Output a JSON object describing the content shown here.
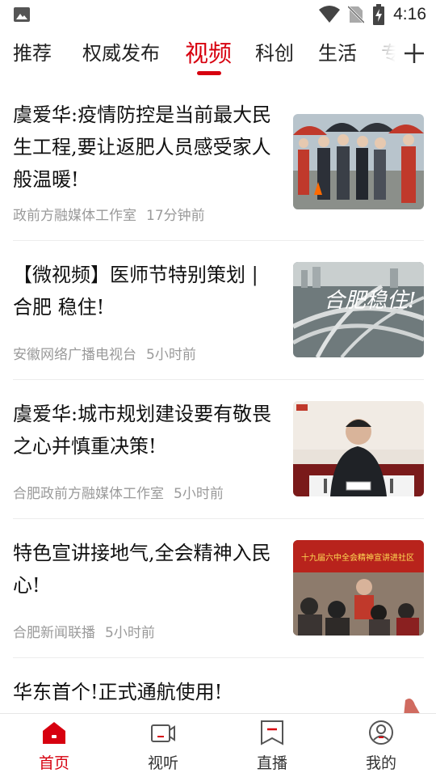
{
  "status_bar": {
    "time": "4:16"
  },
  "tabs": [
    {
      "label": "推荐"
    },
    {
      "label": "权威发布"
    },
    {
      "label": "视频",
      "active": true
    },
    {
      "label": "科创"
    },
    {
      "label": "生活"
    },
    {
      "label": "专"
    }
  ],
  "news": [
    {
      "title": "虞爱华:疫情防控是当前最大民生工程,要让返肥人员感受家人般温暖!",
      "source": "政前方融媒体工作室",
      "time": "17分钟前"
    },
    {
      "title": "【微视频】医师节特别策划 | 合肥 稳住!",
      "source": "安徽网络广播电视台",
      "time": "5小时前",
      "image_text": "合肥稳住!"
    },
    {
      "title": "虞爱华:城市规划建设要有敬畏之心并慎重决策!",
      "source": "合肥政前方融媒体工作室",
      "time": "5小时前"
    },
    {
      "title": "特色宣讲接地气,全会精神入民心!",
      "source": "合肥新闻联播",
      "time": "5小时前",
      "image_text": "十九届六中全会精神宣讲进社区"
    },
    {
      "title": "华东首个!正式通航使用!"
    }
  ],
  "bottom_nav": [
    {
      "label": "首页",
      "icon": "home-icon",
      "active": true
    },
    {
      "label": "视听",
      "icon": "video-icon"
    },
    {
      "label": "直播",
      "icon": "live-icon"
    },
    {
      "label": "我的",
      "icon": "profile-icon"
    }
  ],
  "colors": {
    "accent": "#d7000f",
    "meta_text": "#9a9a9a",
    "divider": "#ececec"
  }
}
